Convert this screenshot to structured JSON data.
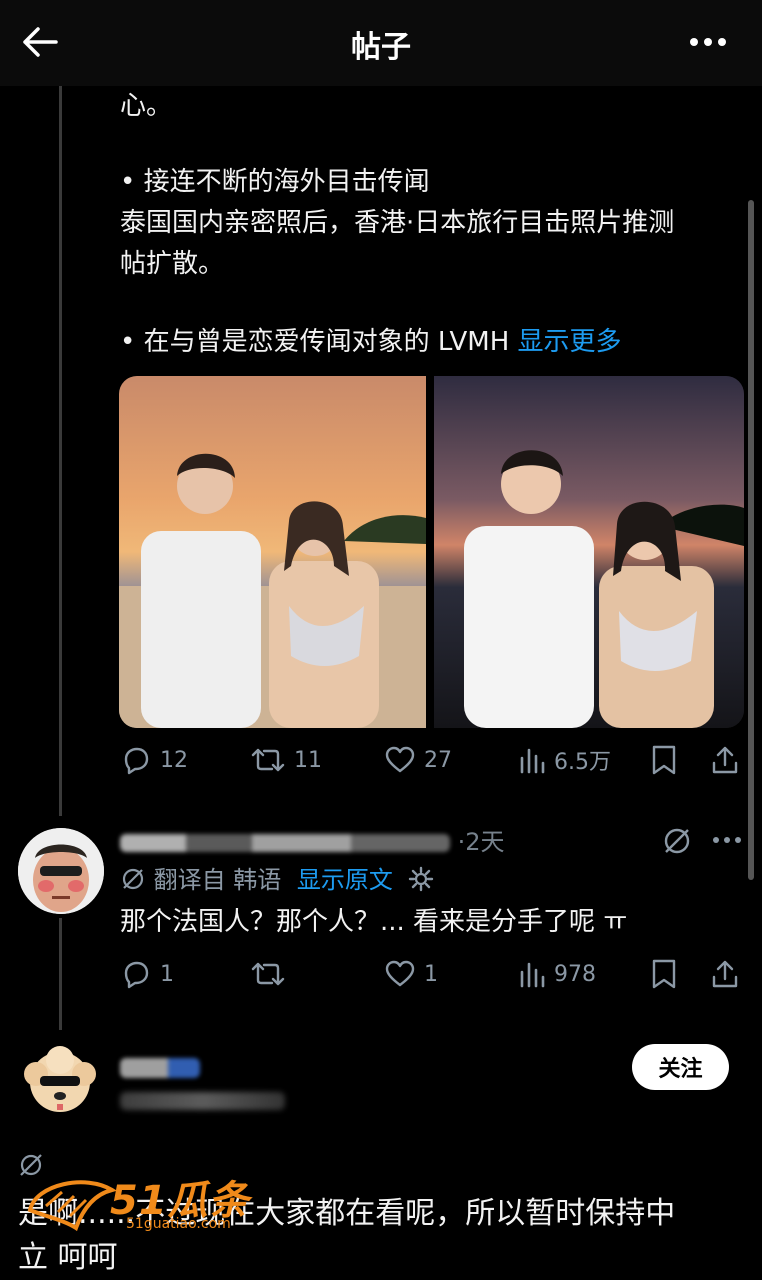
{
  "header": {
    "title": "帖子"
  },
  "post": {
    "line1": "心。",
    "line2": "• 接连不断的海外目击传闻",
    "line3": "泰国国内亲密照后，香港·日本旅行目击照片推测",
    "line4": "帖扩散。",
    "line5": "• 在与曾是恋爱传闻对象的 LVMH ",
    "show_more": "显示更多",
    "stats": {
      "replies": "12",
      "reposts": "11",
      "likes": "27",
      "views": "6.5万"
    }
  },
  "reply1": {
    "meta": "·2天",
    "translated_from": "翻译自 韩语",
    "show_original": "显示原文",
    "text": "那个法国人？那个人？... 看来是分手了呢 ㅠ",
    "stats": {
      "replies": "1",
      "likes": "1",
      "views": "978"
    }
  },
  "reply2": {
    "follow_label": "关注",
    "text_line1": "是啊......不过现在大家都在看呢，所以暂时保持中",
    "text_line2": "立 呵呵"
  },
  "watermark": {
    "text": "51瓜条",
    "sub": "51guatiao.com"
  },
  "colors": {
    "accent": "#1d9bf0",
    "background": "#000000",
    "muted": "#8b98a5"
  }
}
